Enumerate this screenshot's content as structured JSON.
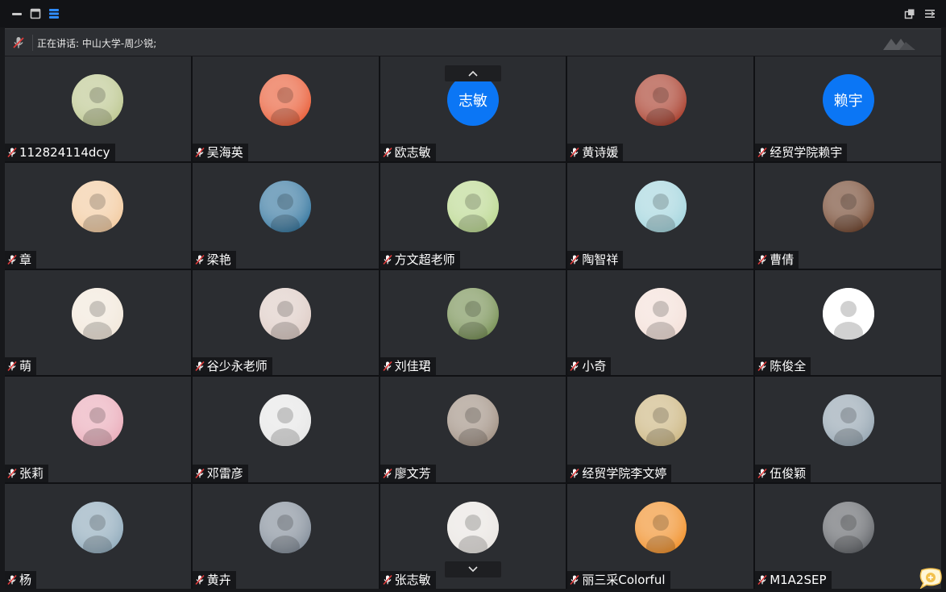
{
  "window": {
    "title_buttons": [
      "minimize-icon",
      "restore-icon",
      "layout-icon"
    ],
    "right_buttons": [
      "share-icon",
      "collapse-icon"
    ]
  },
  "speaking": {
    "text": "正在讲话: 中山大学-周少锐;"
  },
  "participants": [
    {
      "name": "112824114dcy",
      "avatar_text": "",
      "color": "#b9c48a"
    },
    {
      "name": "吴海英",
      "avatar_text": "",
      "color": "#e8542c"
    },
    {
      "name": "欧志敏",
      "avatar_text": "志敏",
      "color": "#0b76f5"
    },
    {
      "name": "黄诗媛",
      "avatar_text": "",
      "color": "#a3321f"
    },
    {
      "name": "经贸学院赖宇",
      "avatar_text": "赖宇",
      "color": "#0b76f5"
    },
    {
      "name": "章",
      "avatar_text": "",
      "color": "#f2c89b"
    },
    {
      "name": "梁艳",
      "avatar_text": "",
      "color": "#2a6f9a"
    },
    {
      "name": "方文超老师",
      "avatar_text": "",
      "color": "#b7d68a"
    },
    {
      "name": "陶智祥",
      "avatar_text": "",
      "color": "#9fd3dc"
    },
    {
      "name": "曹倩",
      "avatar_text": "",
      "color": "#6a3b22"
    },
    {
      "name": "萌",
      "avatar_text": "",
      "color": "#f1e6d8"
    },
    {
      "name": "谷少永老师",
      "avatar_text": "",
      "color": "#dcc9c2"
    },
    {
      "name": "刘佳珺",
      "avatar_text": "",
      "color": "#6f8a4a"
    },
    {
      "name": "小奇",
      "avatar_text": "",
      "color": "#f3ded6"
    },
    {
      "name": "陈俊全",
      "avatar_text": "",
      "color": "#ffffff"
    },
    {
      "name": "张莉",
      "avatar_text": "",
      "color": "#e9a7b6"
    },
    {
      "name": "邓雷彦",
      "avatar_text": "",
      "color": "#e5e5e5"
    },
    {
      "name": "廖文芳",
      "avatar_text": "",
      "color": "#9b8a7c"
    },
    {
      "name": "经贸学院李文婷",
      "avatar_text": "",
      "color": "#c9b27a"
    },
    {
      "name": "伍俊颖",
      "avatar_text": "",
      "color": "#8fa0ad"
    },
    {
      "name": "杨",
      "avatar_text": "",
      "color": "#8aa6b8"
    },
    {
      "name": "黄卉",
      "avatar_text": "",
      "color": "#7c8794"
    },
    {
      "name": "张志敏",
      "avatar_text": "",
      "color": "#e8e4e0"
    },
    {
      "name": "丽三采Colorful",
      "avatar_text": "",
      "color": "#f08a1e"
    },
    {
      "name": "M1A2SEP",
      "avatar_text": "",
      "color": "#5a5d62"
    }
  ],
  "colors": {
    "mic_muted": "#e03a3a",
    "accent": "#0b76f5"
  }
}
